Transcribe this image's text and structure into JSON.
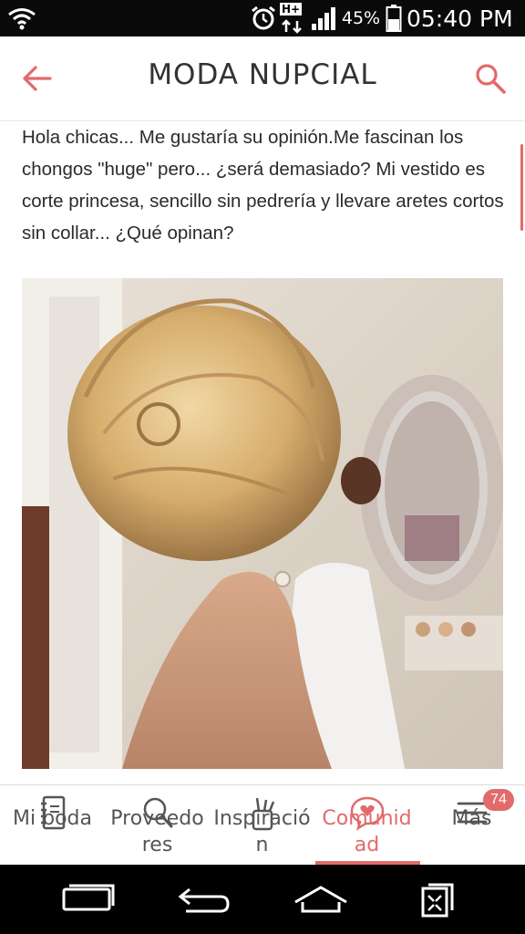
{
  "status_bar": {
    "battery_percent": "45%",
    "time": "05:40 PM",
    "network": "H+",
    "icons": [
      "wifi-icon",
      "alarm-icon",
      "network-type-icon",
      "signal-icon",
      "battery-icon"
    ]
  },
  "header": {
    "title": "MODA NUPCIAL",
    "back_icon": "arrow-left-icon",
    "search_icon": "search-icon",
    "accent_color": "#e26a6a"
  },
  "post": {
    "text": "Hola chicas... Me gustaría su opinión.Me fascinan los chongos \"huge\" pero... ¿será demasiado? Mi vestido es corte princesa, sencillo sin pedrería y llevare aretes cortos sin collar... ¿Qué opinan?",
    "image_alt": "bridal updo hairstyle photo"
  },
  "tabs": [
    {
      "label": "Mi boda",
      "icon": "notebook-icon",
      "active": false
    },
    {
      "label": "Proveedores",
      "icon": "search-icon",
      "active": false
    },
    {
      "label": "Inspiración",
      "icon": "brush-icon",
      "active": false
    },
    {
      "label": "Comunidad",
      "icon": "heart-chat-icon",
      "active": true
    },
    {
      "label": "Más",
      "icon": "menu-icon",
      "active": false,
      "badge": "74"
    }
  ],
  "nav_bar": {
    "icons": [
      "recent-apps-icon",
      "back-icon",
      "home-icon",
      "screen-capture-icon"
    ]
  }
}
